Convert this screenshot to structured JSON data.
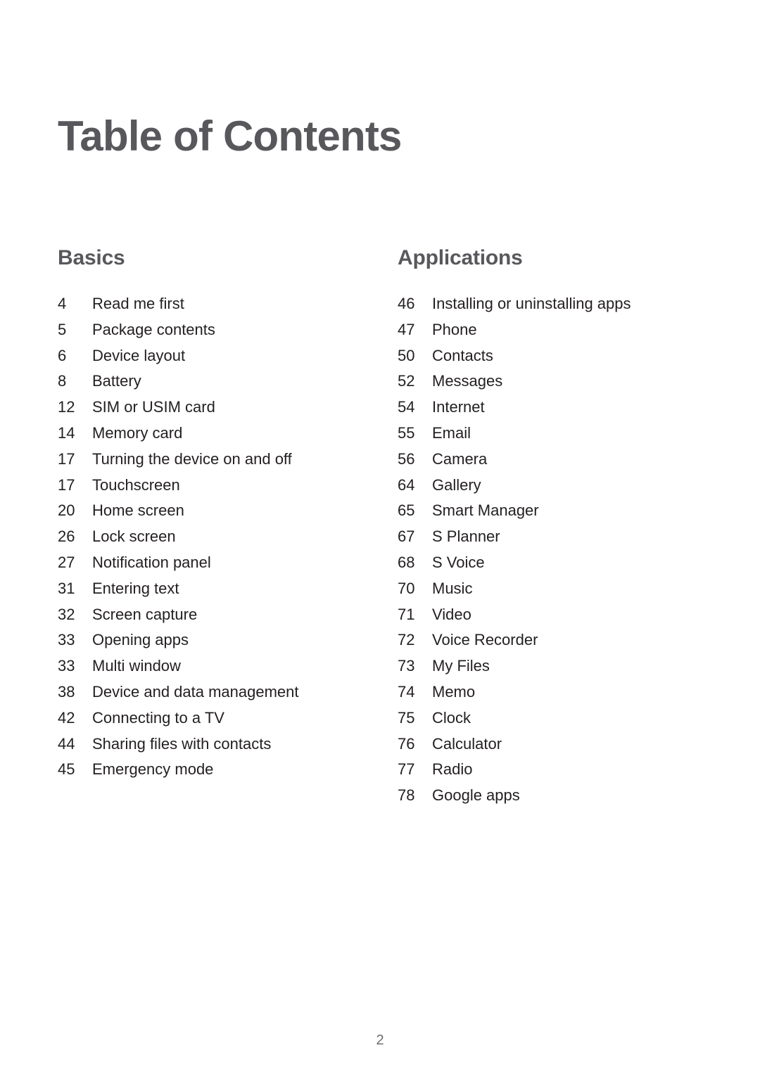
{
  "document": {
    "title": "Table of Contents",
    "footer_page_number": "2"
  },
  "colors": {
    "heading": "#58585c",
    "body_text": "#231f20",
    "footer_text": "#6d6e71",
    "background": "#ffffff"
  },
  "columns": [
    {
      "heading": "Basics",
      "entries": [
        {
          "page": "4",
          "label": "Read me first"
        },
        {
          "page": "5",
          "label": "Package contents"
        },
        {
          "page": "6",
          "label": "Device layout"
        },
        {
          "page": "8",
          "label": "Battery"
        },
        {
          "page": "12",
          "label": "SIM or USIM card"
        },
        {
          "page": "14",
          "label": "Memory card"
        },
        {
          "page": "17",
          "label": "Turning the device on and off"
        },
        {
          "page": "17",
          "label": "Touchscreen"
        },
        {
          "page": "20",
          "label": "Home screen"
        },
        {
          "page": "26",
          "label": "Lock screen"
        },
        {
          "page": "27",
          "label": "Notification panel"
        },
        {
          "page": "31",
          "label": "Entering text"
        },
        {
          "page": "32",
          "label": "Screen capture"
        },
        {
          "page": "33",
          "label": "Opening apps"
        },
        {
          "page": "33",
          "label": "Multi window"
        },
        {
          "page": "38",
          "label": "Device and data management"
        },
        {
          "page": "42",
          "label": "Connecting to a TV"
        },
        {
          "page": "44",
          "label": "Sharing files with contacts"
        },
        {
          "page": "45",
          "label": "Emergency mode"
        }
      ]
    },
    {
      "heading": "Applications",
      "entries": [
        {
          "page": "46",
          "label": "Installing or uninstalling apps"
        },
        {
          "page": "47",
          "label": "Phone"
        },
        {
          "page": "50",
          "label": "Contacts"
        },
        {
          "page": "52",
          "label": "Messages"
        },
        {
          "page": "54",
          "label": "Internet"
        },
        {
          "page": "55",
          "label": "Email"
        },
        {
          "page": "56",
          "label": "Camera"
        },
        {
          "page": "64",
          "label": "Gallery"
        },
        {
          "page": "65",
          "label": "Smart Manager"
        },
        {
          "page": "67",
          "label": "S Planner"
        },
        {
          "page": "68",
          "label": "S Voice"
        },
        {
          "page": "70",
          "label": "Music"
        },
        {
          "page": "71",
          "label": "Video"
        },
        {
          "page": "72",
          "label": "Voice Recorder"
        },
        {
          "page": "73",
          "label": "My Files"
        },
        {
          "page": "74",
          "label": "Memo"
        },
        {
          "page": "75",
          "label": "Clock"
        },
        {
          "page": "76",
          "label": "Calculator"
        },
        {
          "page": "77",
          "label": "Radio"
        },
        {
          "page": "78",
          "label": "Google apps"
        }
      ]
    }
  ]
}
